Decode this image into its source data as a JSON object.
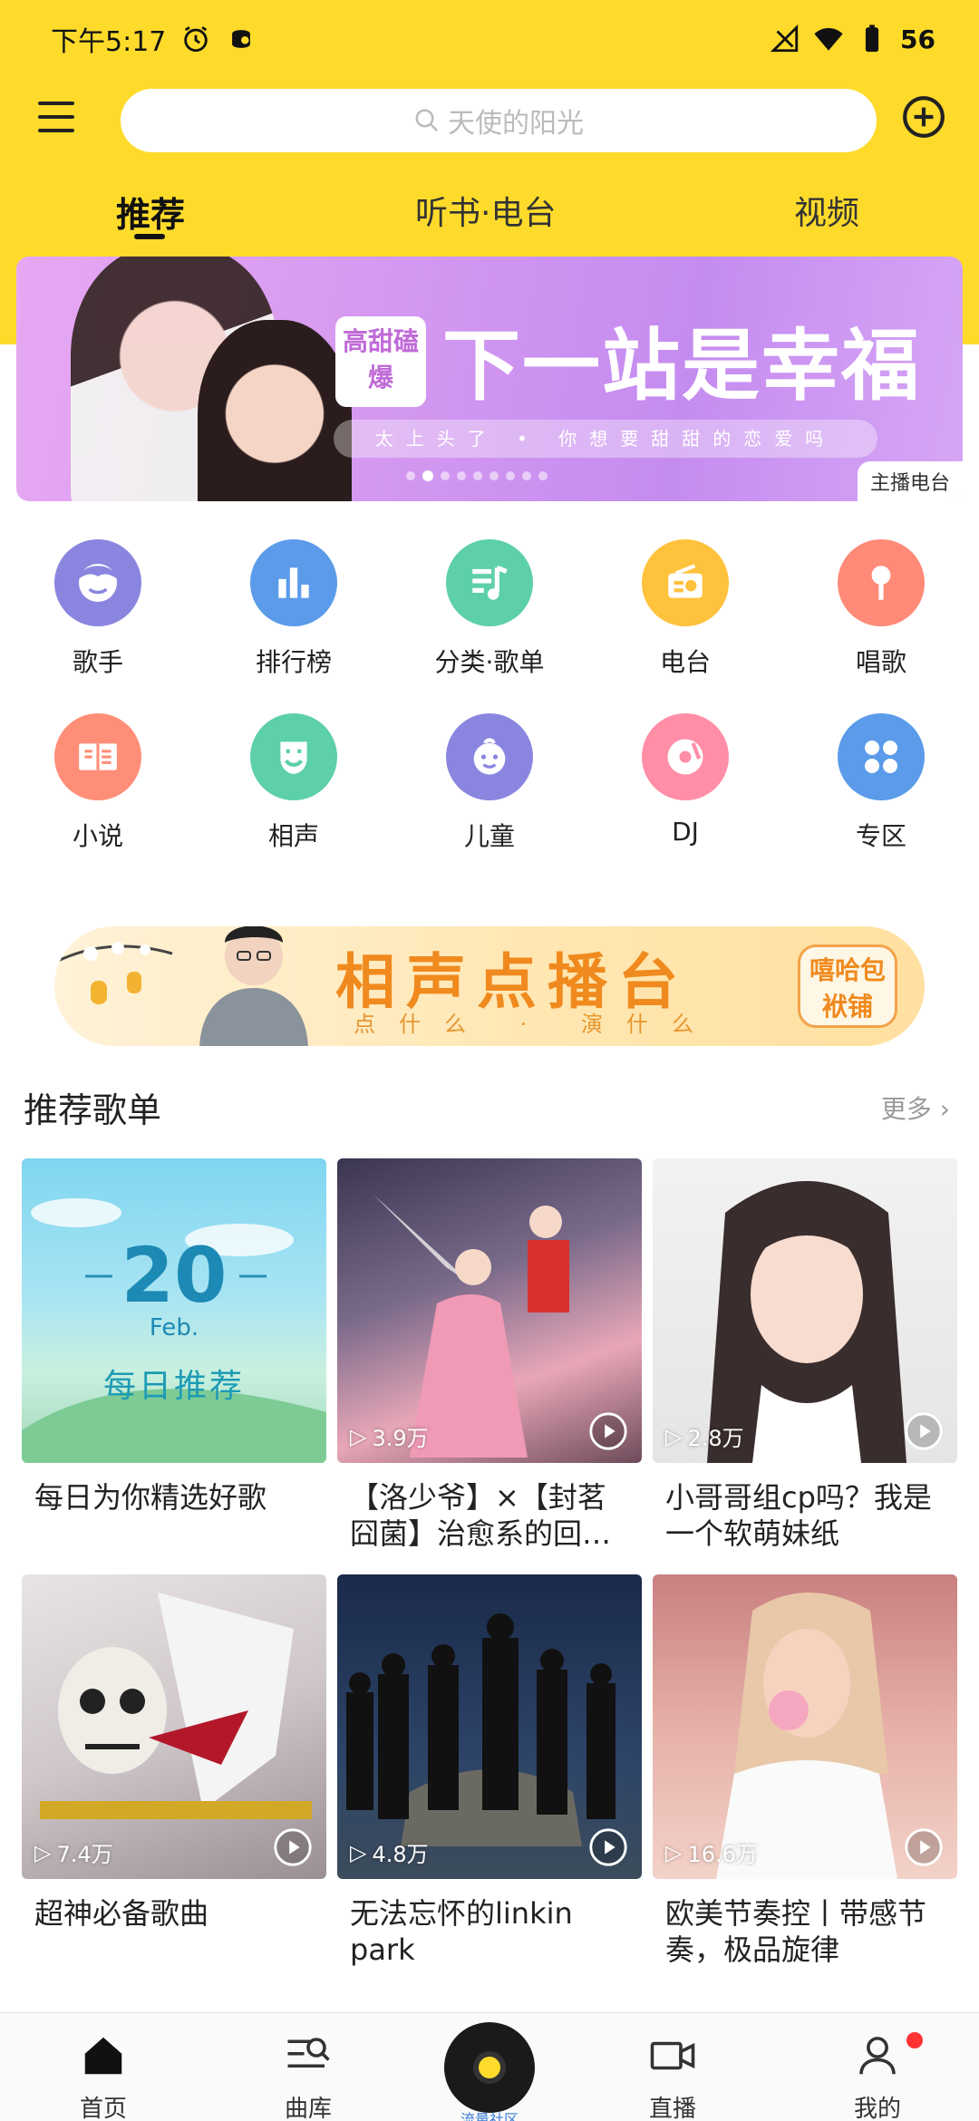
{
  "status_bar": {
    "time": "下午5:17",
    "battery": "56"
  },
  "header": {
    "search_placeholder": "天使的阳光"
  },
  "tabs": [
    {
      "label": "推荐",
      "active": true
    },
    {
      "label": "听书·电台",
      "active": false
    },
    {
      "label": "视频",
      "active": false
    }
  ],
  "banner": {
    "badge": "高甜磕爆",
    "title": "下一站是幸福",
    "subtitle": "太上头了 • 你想要甜甜的恋爱吗",
    "tag": "主播电台",
    "dots_total": 9,
    "dots_active_index": 1
  },
  "grid": [
    {
      "label": "歌手",
      "color": "#8A86E0",
      "icon": "singer-icon"
    },
    {
      "label": "排行榜",
      "color": "#5B9BEA",
      "icon": "chart-icon"
    },
    {
      "label": "分类·歌单",
      "color": "#5DD0A8",
      "icon": "playlist-icon"
    },
    {
      "label": "电台",
      "color": "#FFC23D",
      "icon": "radio-icon"
    },
    {
      "label": "唱歌",
      "color": "#FF8A78",
      "icon": "microphone-icon"
    },
    {
      "label": "小说",
      "color": "#FF8E78",
      "icon": "book-icon"
    },
    {
      "label": "相声",
      "color": "#5DD0A8",
      "icon": "mask-icon"
    },
    {
      "label": "儿童",
      "color": "#8A86E0",
      "icon": "baby-icon"
    },
    {
      "label": "DJ",
      "color": "#FF8EA6",
      "icon": "dj-disc-icon"
    },
    {
      "label": "专区",
      "color": "#5B9BEA",
      "icon": "grid-icon"
    }
  ],
  "xiangsheng_banner": {
    "title": "相声点播台",
    "subtitle": "点什么 · 演什么",
    "badge": "嘻哈包袱铺"
  },
  "section": {
    "title": "推荐歌单",
    "more": "更多"
  },
  "daily": {
    "day": "20",
    "month": "Feb.",
    "label": "每日推荐"
  },
  "playlists": [
    {
      "title": "每日为你精选好歌",
      "count": ""
    },
    {
      "title": "【洛少爷】×【封茗囧菌】治愈系的回…",
      "count": "3.9万"
    },
    {
      "title": "小哥哥组cp吗？我是一个软萌妹纸",
      "count": "2.8万"
    },
    {
      "title": "超神必备歌曲",
      "count": "7.4万"
    },
    {
      "title": "无法忘怀的linkin park",
      "count": "4.8万"
    },
    {
      "title": "欧美节奏控丨带感节奏，极品旋律",
      "count": "16.6万"
    }
  ],
  "bottom_nav": {
    "home": "首页",
    "library": "曲库",
    "center": "流量社区",
    "live": "直播",
    "mine": "我的"
  }
}
